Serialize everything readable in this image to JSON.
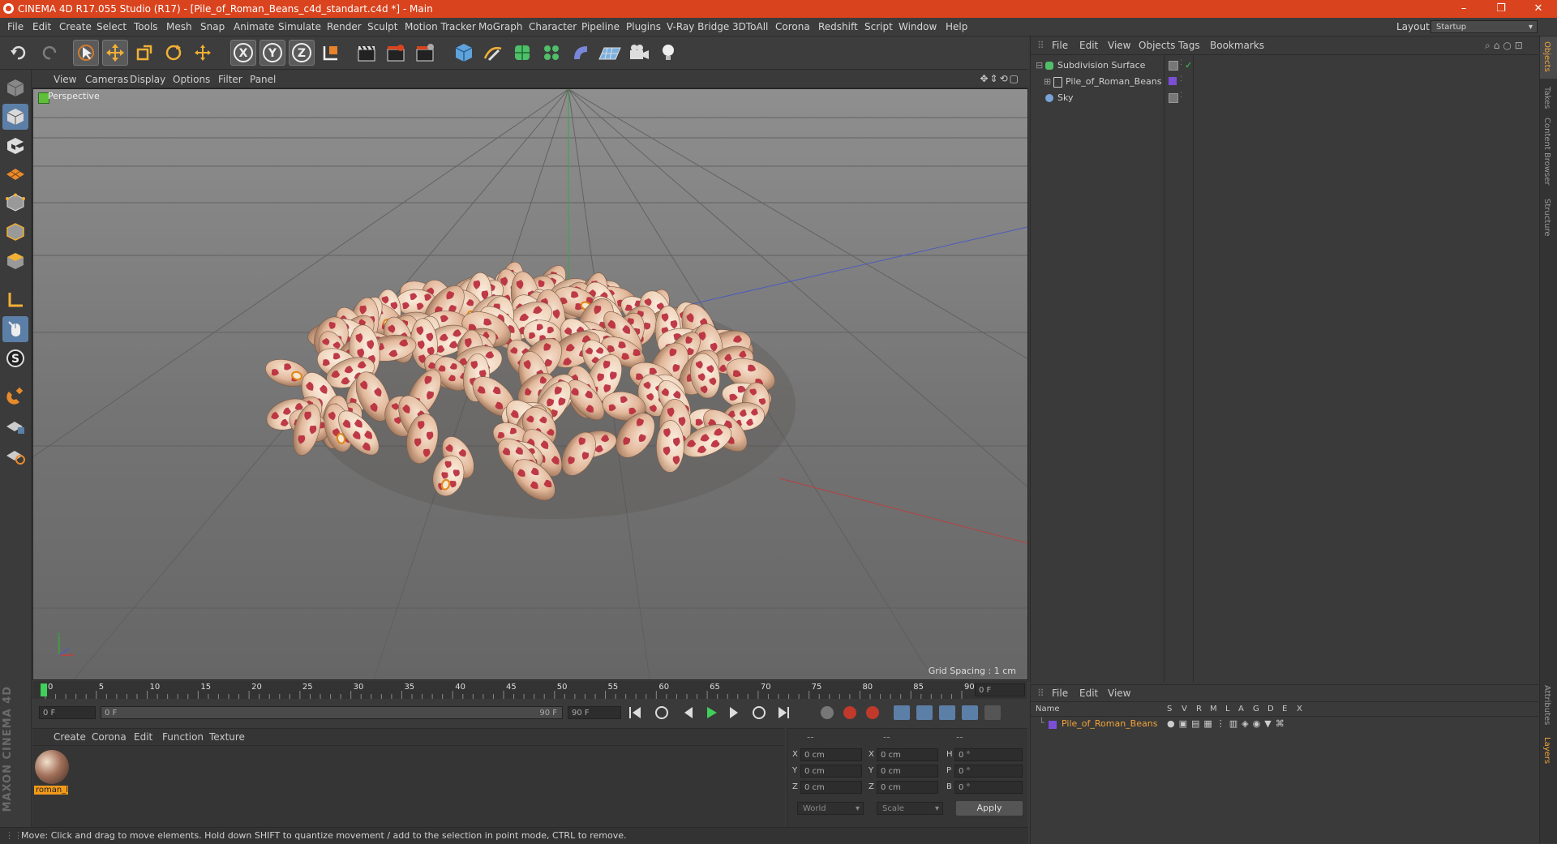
{
  "window": {
    "title": "CINEMA 4D R17.055 Studio (R17) - [Pile_of_Roman_Beans_c4d_standart.c4d *] - Main",
    "controls": [
      "–",
      "❐",
      "✕"
    ]
  },
  "menu": {
    "items": [
      "File",
      "Edit",
      "Create",
      "Select",
      "Tools",
      "Mesh",
      "Snap",
      "Animate",
      "Simulate",
      "Render",
      "Sculpt",
      "Motion Tracker",
      "MoGraph",
      "Character",
      "Pipeline",
      "Plugins",
      "V-Ray Bridge",
      "3DToAll",
      "Corona",
      "Redshift",
      "Script",
      "Window",
      "Help"
    ],
    "layout_label": "Layout:",
    "layout_value": "Startup"
  },
  "viewport": {
    "menu": [
      "View",
      "Cameras",
      "Display",
      "Options",
      "Filter",
      "Panel"
    ],
    "camera_label": "Perspective",
    "grid_spacing": "Grid Spacing : 1 cm"
  },
  "timeline": {
    "ticks": [
      "0",
      "5",
      "10",
      "15",
      "20",
      "25",
      "30",
      "35",
      "40",
      "45",
      "50",
      "55",
      "60",
      "65",
      "70",
      "75",
      "80",
      "85",
      "90"
    ],
    "current_frame": "0 F"
  },
  "transport": {
    "start_field": "0 F",
    "range_start": "0 F",
    "range_end": "90 F",
    "end_field": "90 F"
  },
  "material_manager": {
    "menu": [
      "Create",
      "Corona",
      "Edit",
      "Function",
      "Texture"
    ],
    "material_name": "roman_l"
  },
  "coordinates": {
    "headers": [
      "--",
      "--",
      "--"
    ],
    "rows": [
      {
        "a": "X",
        "av": "0 cm",
        "b": "X",
        "bv": "0 cm",
        "c": "H",
        "cv": "0 °"
      },
      {
        "a": "Y",
        "av": "0 cm",
        "b": "Y",
        "bv": "0 cm",
        "c": "P",
        "cv": "0 °"
      },
      {
        "a": "Z",
        "av": "0 cm",
        "b": "Z",
        "bv": "0 cm",
        "c": "B",
        "cv": "0 °"
      }
    ],
    "mode": "World",
    "scale": "Scale",
    "apply": "Apply"
  },
  "object_manager": {
    "menu": [
      "File",
      "Edit",
      "View",
      "Objects",
      "Tags",
      "Bookmarks"
    ],
    "objects": [
      {
        "name": "Subdivision Surface"
      },
      {
        "name": "Pile_of_Roman_Beans"
      },
      {
        "name": "Sky"
      }
    ]
  },
  "layer_manager": {
    "menu": [
      "File",
      "Edit",
      "View"
    ],
    "name_header": "Name",
    "columns": [
      "S",
      "V",
      "R",
      "M",
      "L",
      "A",
      "G",
      "D",
      "E",
      "X"
    ],
    "layer": "Pile_of_Roman_Beans"
  },
  "side_tabs": [
    "Objects",
    "Takes",
    "Content Browser",
    "Structure",
    "Attributes",
    "Layers"
  ],
  "status_text": "Move: Click and drag to move elements. Hold down SHIFT to quantize movement / add to the selection in point mode, CTRL to remove.",
  "branding": "MAXON CINEMA 4D",
  "colors": {
    "titlebar": "#d9431e",
    "accent_blue": "#5c7fa8",
    "bean_red": "#b8283a",
    "bean_cream": "#f0d9c4",
    "layer_purple": "#7b4fd6"
  }
}
